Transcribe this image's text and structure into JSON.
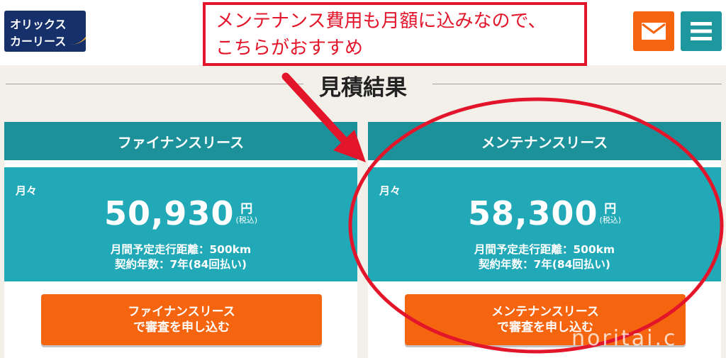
{
  "header": {
    "logo": {
      "line1": "オリックス",
      "line2": "カーリース"
    },
    "callout": {
      "line1": "メンテナンス費用も月額に込みなので、",
      "line2": "こちらがおすすめ"
    },
    "mail_icon": "mail-icon",
    "menu_icon": "hamburger-menu-icon"
  },
  "section_title": "見積結果",
  "plans": [
    {
      "name": "ファイナンスリース",
      "monthly_label": "月々",
      "price": "50,930",
      "currency": "円",
      "tax_note": "(税込)",
      "distance": "月間予定走行距離：500km",
      "term": "契約年数：7年(84回払い)",
      "apply_line1": "ファイナンスリース",
      "apply_line2": "で審査を申し込む"
    },
    {
      "name": "メンテナンスリース",
      "monthly_label": "月々",
      "price": "58,300",
      "currency": "円",
      "tax_note": "(税込)",
      "distance": "月間予定走行距離：500km",
      "term": "契約年数：7年(84回払い)",
      "apply_line1": "メンテナンスリース",
      "apply_line2": "で審査を申し込む"
    }
  ],
  "watermark": "noritai.c",
  "colors": {
    "accent_orange": "#f5640f",
    "teal_header": "#1c919a",
    "teal_body": "#22a9b8",
    "annotation_red": "#e2152a"
  }
}
